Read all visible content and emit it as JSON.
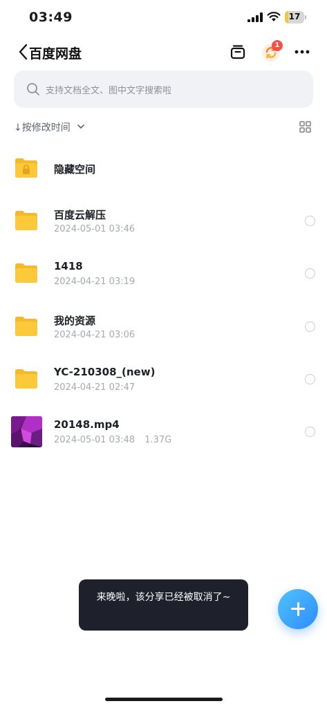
{
  "status_bar": {
    "time": "03:49",
    "battery": "17",
    "battery_level": 0.17
  },
  "header": {
    "title": "百度网盘",
    "notification_count": "1"
  },
  "search": {
    "placeholder": "支持文档全文、图中文字搜索啦"
  },
  "sort": {
    "label": "↓按修改时间"
  },
  "files": [
    {
      "name": "隐藏空间",
      "date": "",
      "size": "",
      "icon": "locked-folder-icon"
    },
    {
      "name": "百度云解压",
      "date": "2024-05-01 03:46",
      "size": "",
      "icon": "folder-icon"
    },
    {
      "name": "1418",
      "date": "2024-04-21 03:19",
      "size": "",
      "icon": "folder-icon"
    },
    {
      "name": "我的资源",
      "date": "2024-04-21 03:06",
      "size": "",
      "icon": "folder-icon"
    },
    {
      "name": "YC-210308_(new)",
      "date": "2024-04-21 02:47",
      "size": "",
      "icon": "folder-icon"
    },
    {
      "name": "20148.mp4",
      "date": "2024-05-01 03:48",
      "size": "1.37G",
      "icon": "video-thumbnail"
    }
  ],
  "toast": {
    "text": "来晚啦，该分享已经被取消了~"
  },
  "colors": {
    "accent": "#2e8cff",
    "folder": "#fcc93a",
    "badge": "#f2514a"
  }
}
